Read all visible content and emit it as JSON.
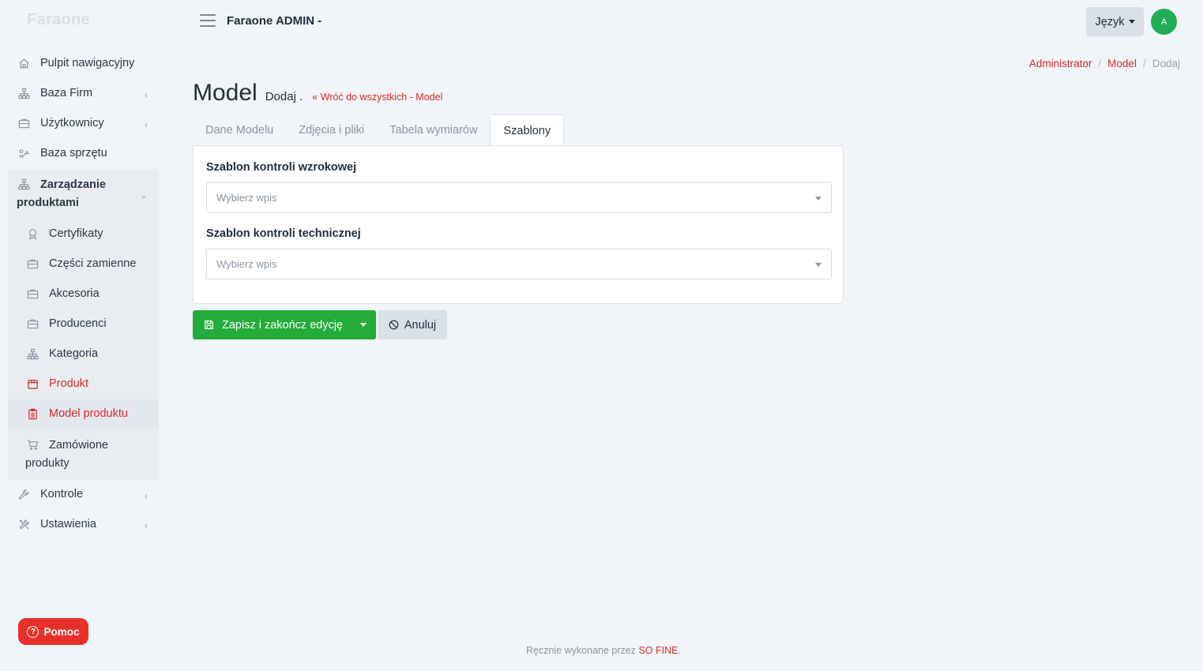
{
  "brand": "Faraone",
  "topbar": {
    "title": "Faraone ADMIN -",
    "language_label": "Język",
    "avatar_initial": "A"
  },
  "sidebar": {
    "items": [
      {
        "label": "Pulpit nawigacyjny",
        "icon": "home-icon"
      },
      {
        "label": "Baza Firm",
        "icon": "sitemap-icon"
      },
      {
        "label": "Użytkownicy",
        "icon": "briefcase-icon"
      },
      {
        "label": "Baza sprzętu",
        "icon": "wrench-icon"
      },
      {
        "label": "Zarządzanie produktami",
        "icon": "sitemap-icon"
      },
      {
        "label": "Kontrole",
        "icon": "wrench-icon"
      },
      {
        "label": "Ustawienia",
        "icon": "tools-icon"
      }
    ],
    "sub_items": [
      {
        "label": "Certyfikaty",
        "icon": "award-icon"
      },
      {
        "label": "Części zamienne",
        "icon": "briefcase-icon"
      },
      {
        "label": "Akcesoria",
        "icon": "briefcase-icon"
      },
      {
        "label": "Producenci",
        "icon": "briefcase-icon"
      },
      {
        "label": "Kategoria",
        "icon": "sitemap-icon"
      },
      {
        "label": "Produkt",
        "icon": "box-icon"
      },
      {
        "label": "Model produktu",
        "icon": "clipboard-icon"
      },
      {
        "label": "Zamówione produkty",
        "icon": "cart-icon"
      }
    ],
    "help_label": "Pomoc"
  },
  "breadcrumb": {
    "items": [
      "Administrator",
      "Model",
      "Dodaj"
    ]
  },
  "page": {
    "title": "Model",
    "subtitle": "Dodaj .",
    "back_link": "Wróć do wszystkich - Model"
  },
  "tabs": [
    "Dane Modelu",
    "Zdjęcia i pliki",
    "Tabela wymiarów",
    "Szablony"
  ],
  "form": {
    "visual_label": "Szablon kontroli wzrokowej",
    "visual_placeholder": "Wybierz wpis",
    "technical_label": "Szablon kontroli technicznej",
    "technical_placeholder": "Wybierz wpis"
  },
  "actions": {
    "save_label": "Zapisz i zakończ edycję",
    "cancel_label": "Anuluj"
  },
  "footer": {
    "text": "Ręcznie wykonane przez",
    "link": "SO FINE",
    "period": "."
  },
  "colors": {
    "accent": "#d42a2a",
    "success": "#24ab3a",
    "help": "#e8302b"
  }
}
